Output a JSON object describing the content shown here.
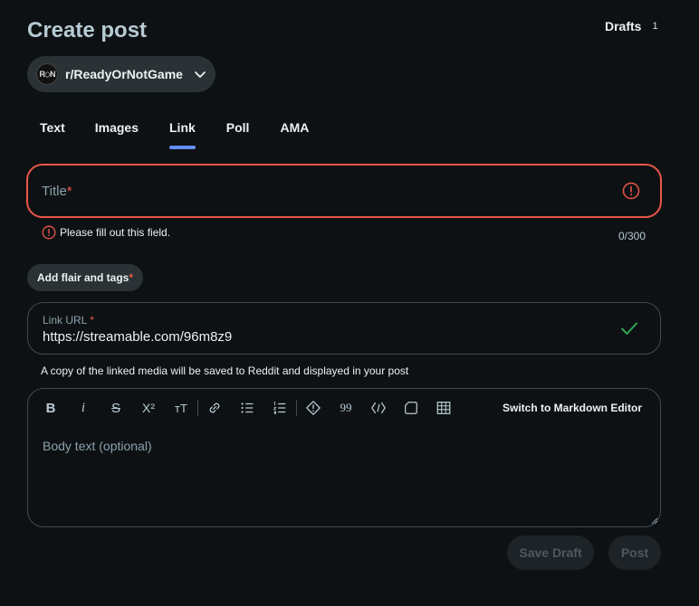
{
  "header": {
    "title": "Create post",
    "drafts_label": "Drafts",
    "drafts_count": "1"
  },
  "community": {
    "avatar_text": "R◇N",
    "name": "r/ReadyOrNotGame"
  },
  "tabs": [
    {
      "label": "Text",
      "active": false
    },
    {
      "label": "Images",
      "active": false
    },
    {
      "label": "Link",
      "active": true
    },
    {
      "label": "Poll",
      "active": false
    },
    {
      "label": "AMA",
      "active": false
    }
  ],
  "title_field": {
    "placeholder": "Title",
    "required_mark": "*",
    "error_message": "Please fill out this field.",
    "char_count": "0/300"
  },
  "flair": {
    "label": "Add flair and tags",
    "required_mark": "*"
  },
  "link_field": {
    "label": "Link URL",
    "required_mark": "*",
    "value": "https://streamable.com/96m8z9",
    "note": "A copy of the linked media will be saved to Reddit and displayed in your post"
  },
  "editor": {
    "toolbar": [
      {
        "icon": "bold-icon",
        "glyph": "B"
      },
      {
        "icon": "italic-icon",
        "glyph": "i"
      },
      {
        "icon": "strikethrough-icon",
        "glyph": "S"
      },
      {
        "icon": "superscript-icon",
        "glyph": "X²"
      },
      {
        "icon": "heading-icon",
        "glyph": "тT"
      },
      {
        "icon": "link-icon",
        "glyph": "🔗"
      },
      {
        "icon": "bullet-list-icon",
        "glyph": "•≡"
      },
      {
        "icon": "numbered-list-icon",
        "glyph": "1≡"
      },
      {
        "icon": "spoiler-icon",
        "glyph": "!"
      },
      {
        "icon": "quote-icon",
        "glyph": "99"
      },
      {
        "icon": "code-icon",
        "glyph": "<>"
      },
      {
        "icon": "code-block-icon",
        "glyph": "▢"
      },
      {
        "icon": "table-icon",
        "glyph": "⊞"
      }
    ],
    "markdown_switch_label": "Switch to Markdown Editor",
    "body_placeholder": "Body text (optional)"
  },
  "actions": {
    "save_draft_label": "Save Draft",
    "post_label": "Post"
  },
  "colors": {
    "background": "#0e1113",
    "error": "#e9574a",
    "success": "#2fa84f",
    "tab_indicator": "#648efc",
    "chip_bg": "#2a3236"
  }
}
